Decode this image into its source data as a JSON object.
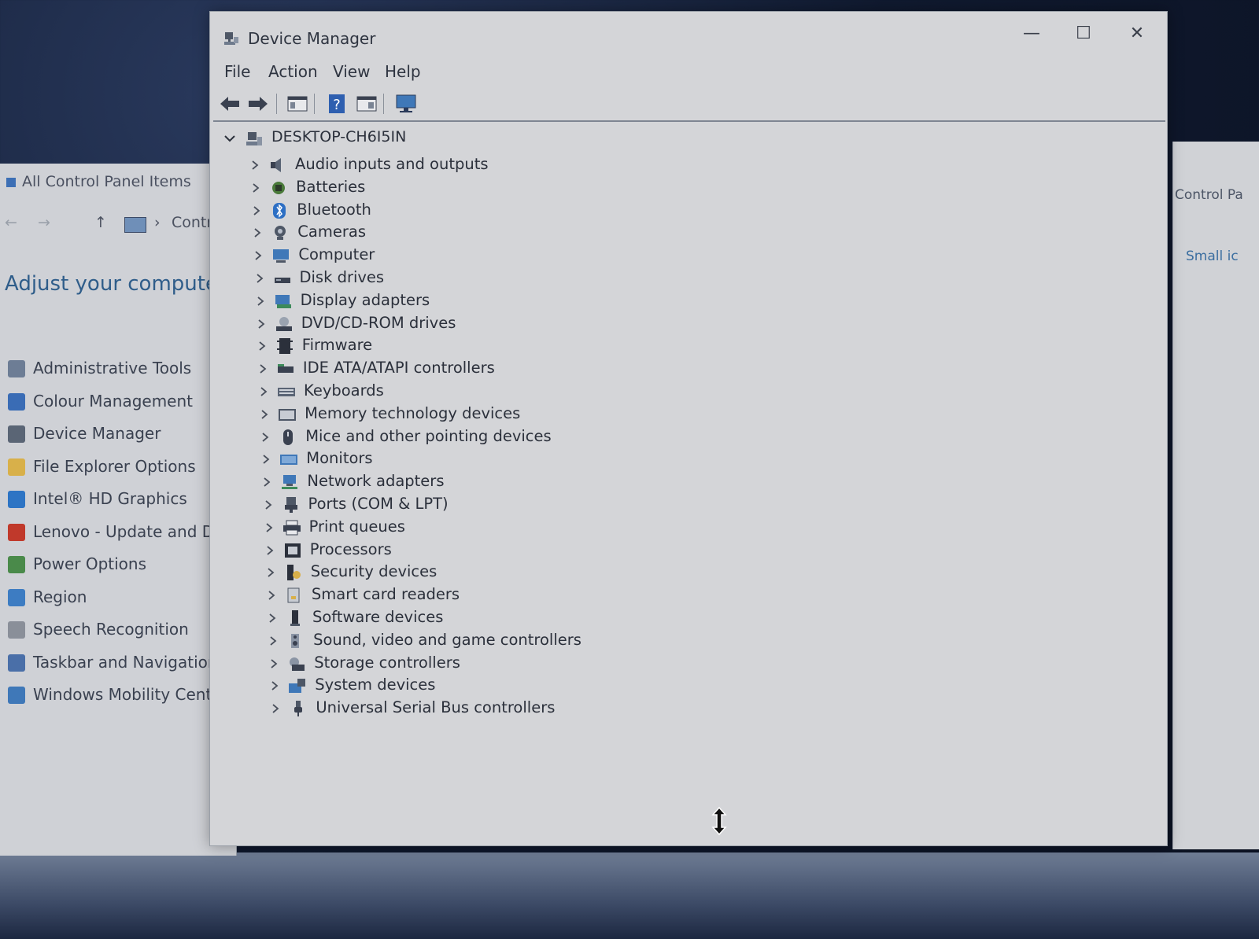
{
  "control_panel": {
    "title": "All Control Panel Items",
    "address_crumb": "Contr",
    "heading": "Adjust your computer's",
    "items": [
      {
        "label": "Administrative Tools",
        "color": "#6d7d95"
      },
      {
        "label": "Colour Management",
        "color": "#3a6cb5"
      },
      {
        "label": "Device Manager",
        "color": "#5a6575"
      },
      {
        "label": "File Explorer Options",
        "color": "#d8b04a"
      },
      {
        "label": "Intel® HD Graphics",
        "color": "#2d74c4"
      },
      {
        "label": "Lenovo - Update and Drive",
        "color": "#c0392b"
      },
      {
        "label": "Power Options",
        "color": "#4a8a4a"
      },
      {
        "label": "Region",
        "color": "#3d7cc2"
      },
      {
        "label": "Speech Recognition",
        "color": "#8a8f99"
      },
      {
        "label": "Taskbar and Navigation",
        "color": "#4a6fa8"
      },
      {
        "label": "Windows Mobility Centre",
        "color": "#3f78b8"
      }
    ]
  },
  "right_window": {
    "crumb": "Control Pa",
    "view_link": "Small ic"
  },
  "device_manager": {
    "title": "Device Manager",
    "menu": [
      "File",
      "Action",
      "View",
      "Help"
    ],
    "root": "DESKTOP-CH6I5IN",
    "categories": [
      {
        "label": "Audio inputs and outputs",
        "icon": "speaker-icon"
      },
      {
        "label": "Batteries",
        "icon": "battery-icon"
      },
      {
        "label": "Bluetooth",
        "icon": "bluetooth-icon"
      },
      {
        "label": "Cameras",
        "icon": "camera-icon"
      },
      {
        "label": "Computer",
        "icon": "computer-icon"
      },
      {
        "label": "Disk drives",
        "icon": "disk-drive-icon"
      },
      {
        "label": "Display adapters",
        "icon": "display-adapter-icon"
      },
      {
        "label": "DVD/CD-ROM drives",
        "icon": "dvd-drive-icon"
      },
      {
        "label": "Firmware",
        "icon": "firmware-icon"
      },
      {
        "label": "IDE ATA/ATAPI controllers",
        "icon": "ide-controller-icon"
      },
      {
        "label": "Keyboards",
        "icon": "keyboard-icon"
      },
      {
        "label": "Memory technology devices",
        "icon": "memory-icon"
      },
      {
        "label": "Mice and other pointing devices",
        "icon": "mouse-icon"
      },
      {
        "label": "Monitors",
        "icon": "monitor-icon"
      },
      {
        "label": "Network adapters",
        "icon": "network-icon"
      },
      {
        "label": "Ports (COM & LPT)",
        "icon": "port-icon"
      },
      {
        "label": "Print queues",
        "icon": "printer-icon"
      },
      {
        "label": "Processors",
        "icon": "processor-icon"
      },
      {
        "label": "Security devices",
        "icon": "security-icon"
      },
      {
        "label": "Smart card readers",
        "icon": "smart-card-icon"
      },
      {
        "label": "Software devices",
        "icon": "software-device-icon"
      },
      {
        "label": "Sound, video and game controllers",
        "icon": "sound-icon"
      },
      {
        "label": "Storage controllers",
        "icon": "storage-icon"
      },
      {
        "label": "System devices",
        "icon": "system-device-icon"
      },
      {
        "label": "Universal Serial Bus controllers",
        "icon": "usb-icon"
      }
    ]
  }
}
